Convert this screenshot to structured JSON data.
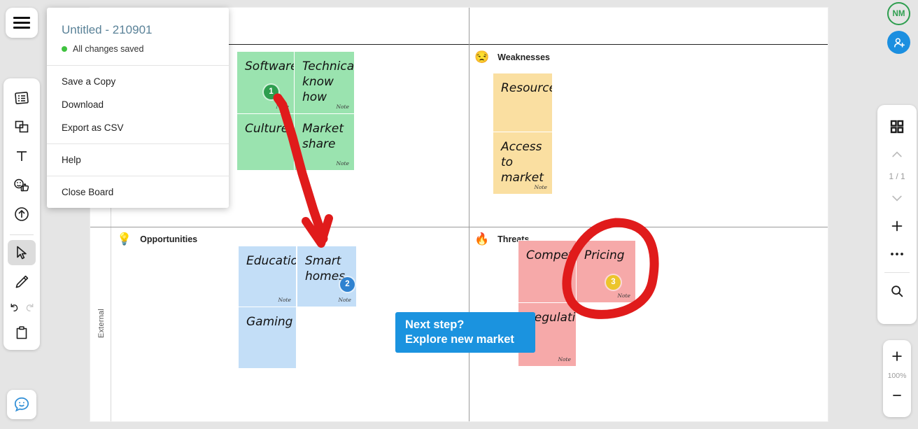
{
  "menu": {
    "title": "Untitled - 210901",
    "status": "All changes saved",
    "groups": [
      {
        "items": [
          {
            "label": "Save a Copy",
            "name": "menu-item-save-a-copy"
          },
          {
            "label": "Download",
            "name": "menu-item-download"
          },
          {
            "label": "Export as CSV",
            "name": "menu-item-export-as-csv"
          }
        ]
      },
      {
        "items": [
          {
            "label": "Help",
            "name": "menu-item-help"
          }
        ]
      },
      {
        "items": [
          {
            "label": "Close Board",
            "name": "menu-item-close-board"
          }
        ]
      }
    ]
  },
  "board": {
    "axis_external": "External",
    "quadrants": [
      {
        "emoji": "😒",
        "label": "Weaknesses"
      },
      {
        "emoji": "💡",
        "label": "Opportunities"
      },
      {
        "emoji": "🔥",
        "label": "Threats"
      }
    ],
    "notes": [
      {
        "text": "Software",
        "author": "Note",
        "badge": "1",
        "badge_color": "#2e9e4f"
      },
      {
        "text": "Technical know how",
        "author": "Note"
      },
      {
        "text": "Culture",
        "author": ""
      },
      {
        "text": "Market share",
        "author": "Note"
      },
      {
        "text": "Resources",
        "author": ""
      },
      {
        "text": "Access to market",
        "author": "Note"
      },
      {
        "text": "Education",
        "author": "Note"
      },
      {
        "text": "Smart homes",
        "author": "Note",
        "badge": "2",
        "badge_color": "#2f82d0"
      },
      {
        "text": "Gaming",
        "author": ""
      },
      {
        "text": "Competition",
        "author": ""
      },
      {
        "text": "Pricing",
        "author": "Note",
        "badge": "3",
        "badge_color": "#ecc52b"
      },
      {
        "text": "Regulations",
        "author": "Note"
      }
    ],
    "callout": {
      "line1": "Next step?",
      "line2": "Explore new market",
      "color": "#1b93df"
    }
  },
  "toolbar": {
    "hamburger": "menu",
    "tools": [
      {
        "name": "note-tool"
      },
      {
        "name": "sticky-note-tool"
      },
      {
        "name": "text-tool"
      },
      {
        "name": "reaction-tool"
      },
      {
        "name": "upload-tool"
      },
      {
        "name": "select-tool"
      },
      {
        "name": "pen-tool"
      },
      {
        "name": "undo-redo-tool"
      },
      {
        "name": "clipboard-tool"
      }
    ],
    "chat": "chat"
  },
  "rail": {
    "avatar_initials": "NM",
    "page_count": "1 / 1",
    "zoom_level": "100%"
  }
}
